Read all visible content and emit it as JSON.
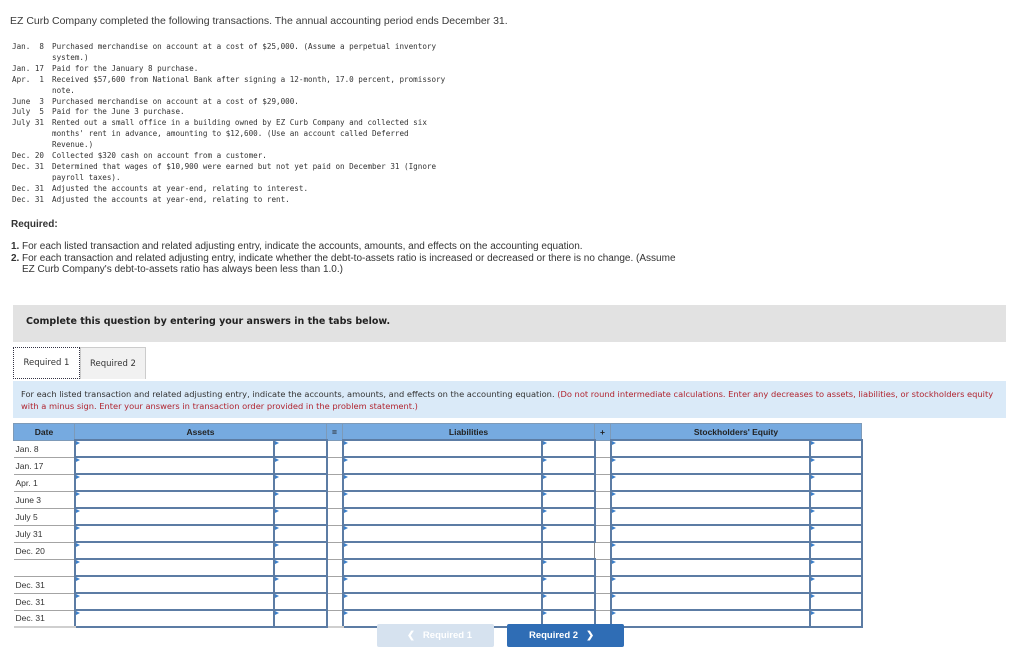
{
  "intro": "EZ Curb Company completed the following transactions. The annual accounting period ends December 31.",
  "transactions": [
    {
      "date": "Jan.  8",
      "text": "Purchased merchandise on account at a cost of $25,000. (Assume a perpetual inventory system.)"
    },
    {
      "date": "Jan. 17",
      "text": "Paid for the January 8 purchase."
    },
    {
      "date": "Apr.  1",
      "text": "Received $57,600 from National Bank after signing a 12-month, 17.0 percent, promissory note."
    },
    {
      "date": "June  3",
      "text": "Purchased merchandise on account at a cost of $29,000."
    },
    {
      "date": "July  5",
      "text": "Paid for the June 3 purchase."
    },
    {
      "date": "July 31",
      "text": "Rented out a small office in a building owned by EZ Curb Company and collected six months' rent in advance, amounting to $12,600. (Use an account called Deferred Revenue.)"
    },
    {
      "date": "Dec. 20",
      "text": "Collected $320 cash on account from a customer."
    },
    {
      "date": "Dec. 31",
      "text": "Determined that wages of $10,900 were earned but not yet paid on December 31 (Ignore payroll taxes)."
    },
    {
      "date": "Dec. 31",
      "text": "Adjusted the accounts at year-end, relating to interest."
    },
    {
      "date": "Dec. 31",
      "text": "Adjusted the accounts at year-end, relating to rent."
    }
  ],
  "required": {
    "heading": "Required:",
    "items": [
      {
        "num": "1.",
        "text": "For each listed transaction and related adjusting entry, indicate the accounts, amounts, and effects on the accounting equation."
      },
      {
        "num": "2.",
        "text": "For each transaction and related adjusting entry, indicate whether the debt-to-assets ratio is increased or decreased or there is no change. (Assume EZ Curb Company's debt-to-assets ratio has always been less than 1.0.)"
      }
    ]
  },
  "panel_text": "Complete this question by entering your answers in the tabs below.",
  "tabs": [
    {
      "label": "Required 1",
      "active": true
    },
    {
      "label": "Required 2",
      "active": false
    }
  ],
  "instructions": {
    "main": "For each listed transaction and related adjusting entry, indicate the accounts, amounts, and effects on the accounting equation.",
    "note": "(Do not round intermediate calculations. Enter any decreases to assets, liabilities, or stockholders equity with a minus sign. Enter your answers in transaction order provided in the problem statement.)"
  },
  "table": {
    "headers": {
      "date": "Date",
      "assets": "Assets",
      "equals": "=",
      "liabilities": "Liabilities",
      "plus": "+",
      "equity": "Stockholders' Equity"
    },
    "rows": [
      {
        "date": "Jan. 8",
        "liab_amount_input": true
      },
      {
        "date": "Jan. 17",
        "liab_amount_input": true
      },
      {
        "date": "Apr. 1",
        "liab_amount_input": true
      },
      {
        "date": "June 3",
        "liab_amount_input": true
      },
      {
        "date": "July 5",
        "liab_amount_input": true
      },
      {
        "date": "July 31",
        "liab_amount_input": true
      },
      {
        "date": "Dec. 20",
        "liab_amount_input": false
      },
      {
        "date": "",
        "liab_amount_input": true
      },
      {
        "date": "Dec. 31",
        "liab_amount_input": true
      },
      {
        "date": "Dec. 31",
        "liab_amount_input": true
      },
      {
        "date": "Dec. 31",
        "liab_amount_input": true
      }
    ]
  },
  "nav": {
    "prev_label": "Required 1",
    "next_label": "Required 2",
    "prev_icon": "chevron-left-icon",
    "next_icon": "chevron-right-icon"
  }
}
